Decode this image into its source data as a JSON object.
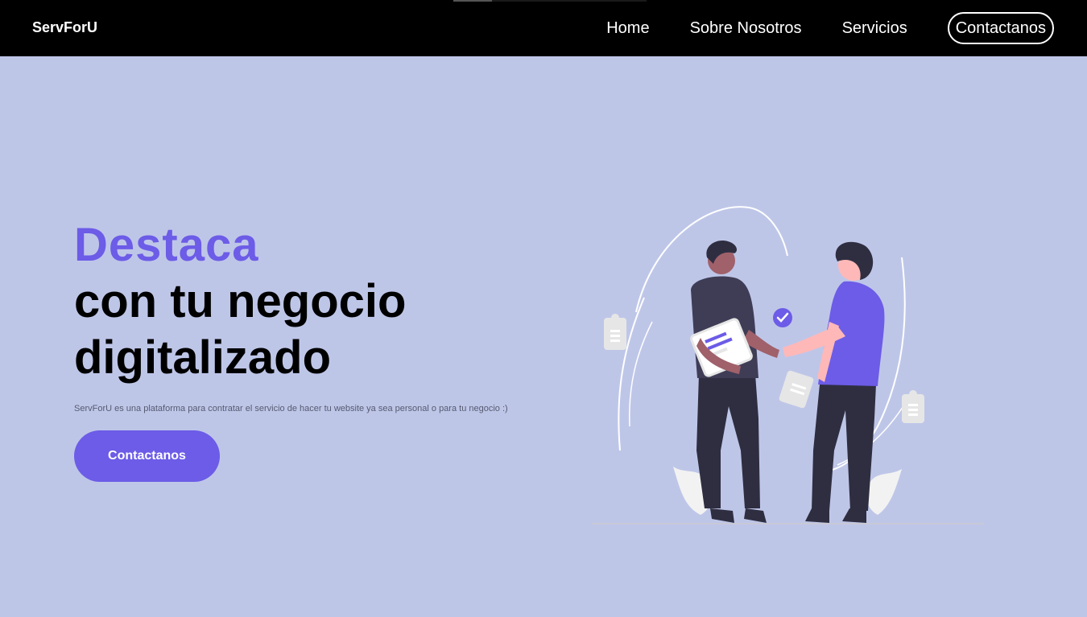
{
  "navbar": {
    "brand": "ServForU",
    "links": [
      "Home",
      "Sobre Nosotros",
      "Servicios"
    ],
    "cta_label": "Contactanos"
  },
  "hero": {
    "title_accent": "Destaca",
    "title_line1": "con tu negocio",
    "title_line2": "digitalizado",
    "description": "ServForU es una plataforma para contratar el servicio de hacer tu website ya sea personal o para tu negocio :)",
    "button_label": "Contactanos"
  },
  "colors": {
    "background": "#bec6e8",
    "navbar": "#000000",
    "accent": "#6c5ce7",
    "text_dark": "#000000"
  },
  "illustration": {
    "icons": [
      "handshake-illustration",
      "check-icon",
      "document-icon"
    ]
  }
}
